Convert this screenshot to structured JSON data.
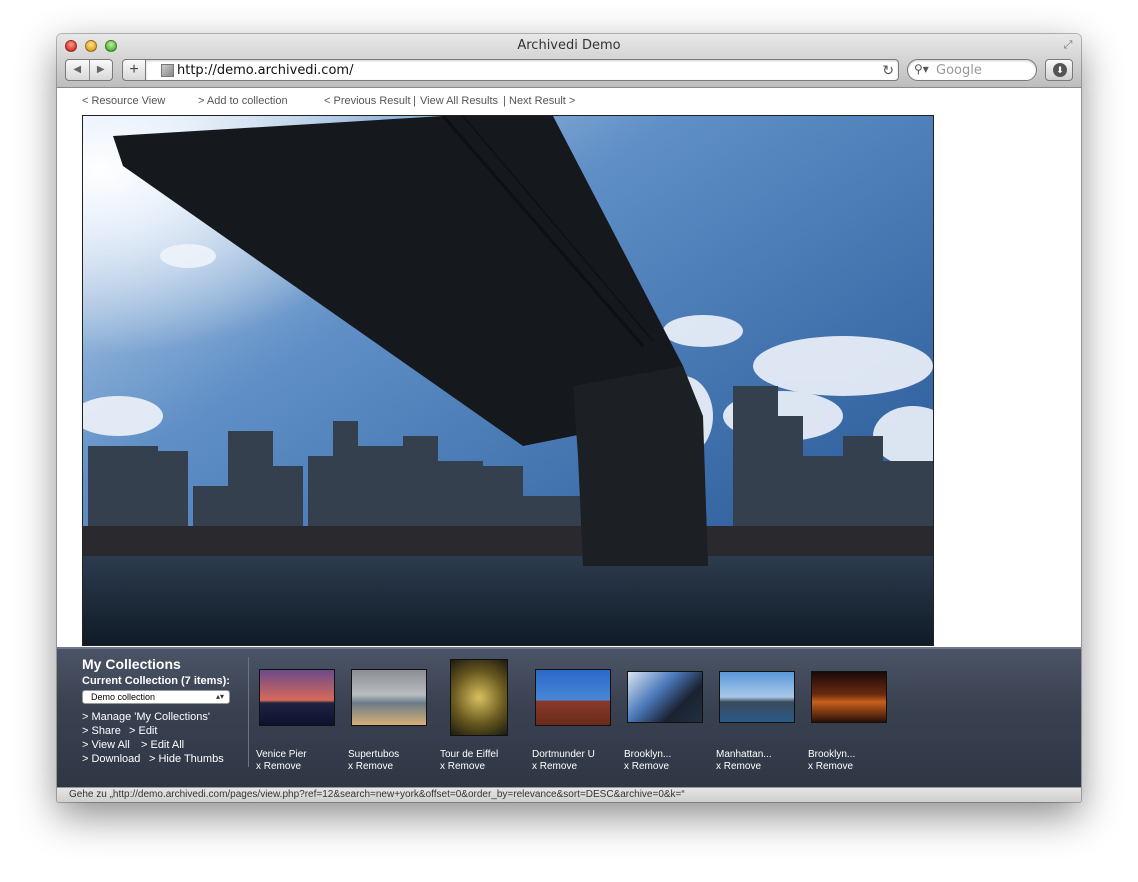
{
  "window": {
    "title": "Archivedi Demo"
  },
  "browser": {
    "url": "http://demo.archivedi.com/",
    "search_placeholder": "Google",
    "back_icon": "back-arrow-icon",
    "forward_icon": "forward-arrow-icon",
    "add_label": "+",
    "reload_glyph": "↻",
    "download_glyph": "⬇",
    "fullscreen_glyph": "⤢"
  },
  "resource_nav": {
    "resource_view": "< Resource View",
    "add_to_collection": "> Add to collection",
    "previous_result": "< Previous Result",
    "sep1": "|",
    "view_all_results": "View All Results",
    "sep2": "|",
    "next_result": "Next Result >"
  },
  "collections": {
    "title": "My Collections",
    "current": "Current Collection (7 items):",
    "selected": "Demo collection",
    "manage": "> Manage 'My Collections'",
    "share": "> Share",
    "edit": "> Edit",
    "view_all": "> View All",
    "edit_all": "> Edit All",
    "download": "> Download",
    "hide_thumbs": "> Hide Thumbs",
    "remove_label": "x Remove",
    "items": [
      {
        "name": "Venice Pier"
      },
      {
        "name": "Supertubos"
      },
      {
        "name": "Tour de Eiffel"
      },
      {
        "name": "Dortmunder U"
      },
      {
        "name": "Brooklyn..."
      },
      {
        "name": "Manhattan..."
      },
      {
        "name": "Brooklyn..."
      }
    ]
  },
  "status": {
    "text": "Gehe zu „http://demo.archivedi.com/pages/view.php?ref=12&search=new+york&offset=0&order_by=relevance&sort=DESC&archive=0&k=“"
  }
}
